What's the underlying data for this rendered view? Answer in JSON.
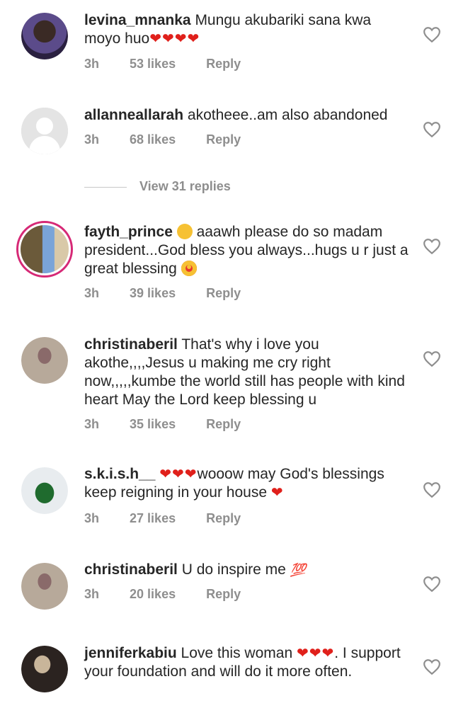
{
  "comments": [
    {
      "username": "levina_mnanka",
      "text": "Mungu akubariki sana kwa moyo huo",
      "hearts": "❤❤❤❤",
      "time": "3h",
      "likes": "53 likes",
      "reply": "Reply"
    },
    {
      "username": "allanneallarah",
      "text": "akotheee..am also abandoned",
      "time": "3h",
      "likes": "68 likes",
      "reply": "Reply"
    },
    {
      "username": "fayth_prince",
      "text": "aaawh please do so madam president...God bless you always...hugs u r just a great blessing",
      "time": "3h",
      "likes": "39 likes",
      "reply": "Reply"
    },
    {
      "username": "christinaberil",
      "text": "That's why i love you akothe,,,,Jesus u making me cry right now,,,,,kumbe the world still has people with kind heart May the Lord keep blessing u",
      "time": "3h",
      "likes": "35 likes",
      "reply": "Reply"
    },
    {
      "username": "s.k.i.s.h__",
      "hearts": "❤❤❤",
      "text": "wooow may God's blessings keep reigning in your house",
      "hearts_end": "❤",
      "time": "3h",
      "likes": "27 likes",
      "reply": "Reply"
    },
    {
      "username": "christinaberil",
      "text": "U do inspire me",
      "emoji": "💯",
      "time": "3h",
      "likes": "20 likes",
      "reply": "Reply"
    },
    {
      "username": "jenniferkabiu",
      "text": "Love this woman",
      "hearts": "❤❤❤",
      "text_after": ". I support your foundation and will do it more often."
    }
  ],
  "view_replies": "View 31 replies",
  "icons": {
    "like": "heart-outline-icon"
  },
  "colors": {
    "text": "#262626",
    "meta": "#8e8e8e",
    "heart": "#e0201b",
    "story_ring": "#d62976"
  }
}
